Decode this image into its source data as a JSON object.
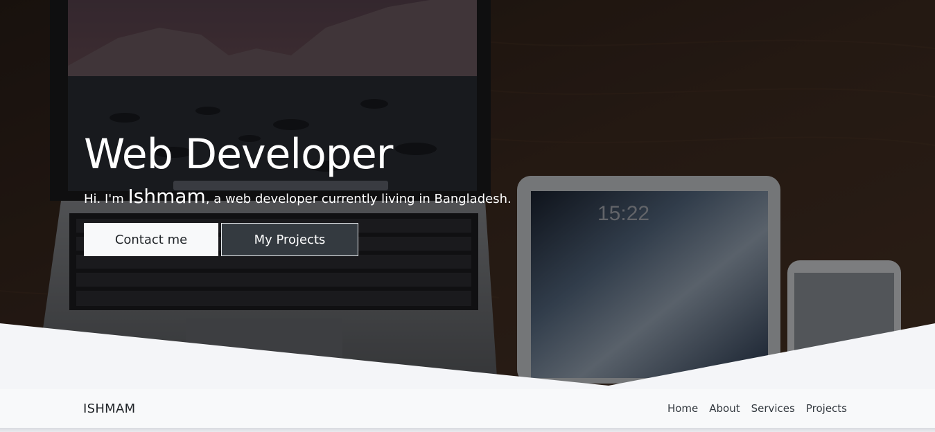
{
  "hero": {
    "title": "Web Developer",
    "greeting_prefix": "Hi. I'm ",
    "name": "Ishmam",
    "greeting_suffix": ", a web developer currently living in Bangladesh.",
    "buttons": {
      "contact": "Contact me",
      "projects": "My Projects"
    },
    "device_clock": "15:22",
    "background_image": "laptop-tablet-phone-on-wooden-desk"
  },
  "navbar": {
    "brand": "ISHMAM",
    "links": [
      "Home",
      "About",
      "Services",
      "Projects"
    ]
  },
  "colors": {
    "page_bg": "#f4f5f8",
    "navbar_bg": "#f8f9fa",
    "btn_light": "#f8f9fa",
    "btn_dark": "#343a40",
    "hero_text": "#ffffff"
  }
}
